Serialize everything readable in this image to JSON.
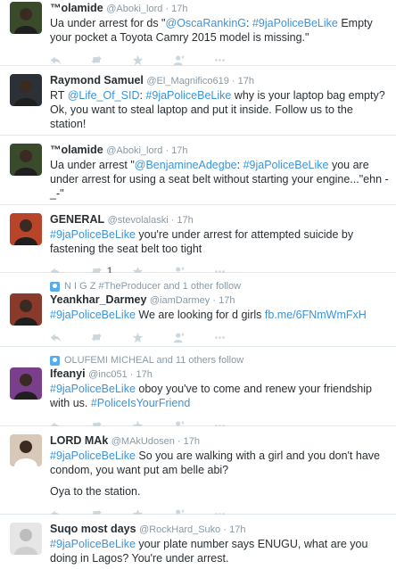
{
  "tweets": [
    {
      "name": "™olamide",
      "handle": "@Aboki_lord",
      "time": "17h",
      "context": "",
      "lines": [
        [
          "Ua under arrest for ds \"",
          "@OscaRankinG",
          ": ",
          "#9jaPoliceBeLike",
          " Empty your pocket a Toyota Camry 2015 model is missing.\""
        ]
      ],
      "retweets": "",
      "avatar_color": "#3a4b2c"
    },
    {
      "name": "Raymond Samuel",
      "handle": "@El_Magnifico619",
      "time": "17h",
      "context": "",
      "lines": [
        [
          "RT ",
          "@Life_Of_SID",
          ": ",
          "#9jaPoliceBeLike",
          " why is your laptop bag empty? Ok, you want to steal laptop and put it inside. Follow us to the station!"
        ]
      ],
      "retweets": "",
      "avatar_color": "#2c3138"
    },
    {
      "name": "™olamide",
      "handle": "@Aboki_lord",
      "time": "17h",
      "context": "",
      "lines": [
        [
          "Ua under arrest \"",
          "@BenjamineAdegbe",
          ": ",
          "#9jaPoliceBeLike",
          " you are under arrest for using a seat belt without starting your engine...\"ehn -_-\""
        ]
      ],
      "retweets": "",
      "avatar_color": "#3a4b2c"
    },
    {
      "name": "GENERAL",
      "handle": "@stevolalaski",
      "time": "17h",
      "context": "",
      "lines": [
        [
          "",
          "",
          "",
          "#9jaPoliceBeLike",
          " you're under arrest for attempted suicide by fastening the seat belt too tight"
        ]
      ],
      "retweets": "1",
      "avatar_color": "#b8442a"
    },
    {
      "name": "Yeankhar_Darmey",
      "handle": "@iamDarmey",
      "time": "17h",
      "context": "N I G Z #TheProducer and 1 other follow",
      "lines": [
        [
          "",
          "",
          "",
          "#9jaPoliceBeLike",
          " We are looking for d girls ",
          "fb.me/6FNmWmFxH"
        ]
      ],
      "retweets": "",
      "avatar_color": "#8a3a2a"
    },
    {
      "name": "Ifeanyi",
      "handle": "@inc051",
      "time": "17h",
      "context": "OLUFEMI MICHEAL and 11 others follow",
      "lines": [
        [
          "",
          "",
          "",
          "#9jaPoliceBeLike",
          " oboy you've to come and renew your friendship with us. ",
          "#PoliceIsYourFriend"
        ]
      ],
      "retweets": "",
      "avatar_color": "#7a3f8a"
    },
    {
      "name": "LORD MAk",
      "handle": "@MAkUdosen",
      "time": "17h",
      "context": "",
      "lines": [
        [
          "",
          "",
          "",
          "#9jaPoliceBeLike",
          " So you are walking with a girl and you don't have condom, you want put am belle abi?"
        ],
        [
          "Oya to the station."
        ]
      ],
      "retweets": "",
      "avatar_color": "#d8c8b8"
    },
    {
      "name": "Suqo most days",
      "handle": "@RockHard_Suko",
      "time": "17h",
      "context": "",
      "lines": [
        [
          "",
          "",
          "",
          "#9jaPoliceBeLike",
          " your plate number says ENUGU, what are you doing in Lagos? You're under arrest."
        ]
      ],
      "retweets": "",
      "avatar_color": "#e6e6e6"
    }
  ],
  "icons": [
    "reply-icon",
    "retweet-icon",
    "favorite-icon",
    "follow-icon",
    "more-icon"
  ]
}
